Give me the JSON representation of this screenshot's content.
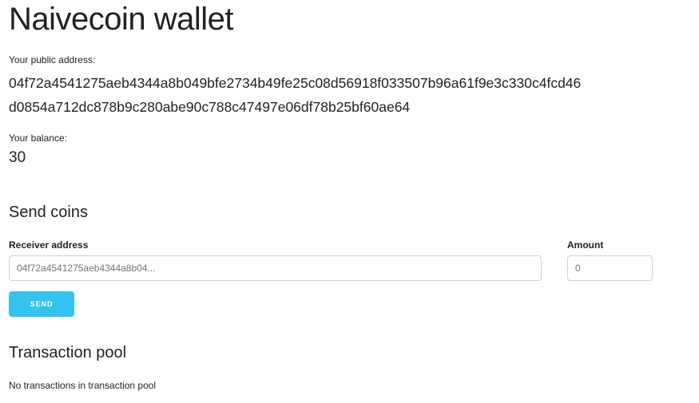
{
  "wallet": {
    "title": "Naivecoin wallet",
    "public_address_label": "Your public address:",
    "public_address_line1": "04f72a4541275aeb4344a8b049bfe2734b49fe25c08d56918f033507b96a61f9e3c330c4fcd46",
    "public_address_line2": "d0854a712dc878b9c280abe90c788c47497e06df78b25bf60ae64",
    "balance_label": "Your balance:",
    "balance_value": "30"
  },
  "send_coins": {
    "heading": "Send coins",
    "receiver_label": "Receiver address",
    "receiver_placeholder": "04f72a4541275aeb4344a8b04...",
    "amount_label": "Amount",
    "amount_placeholder": "0",
    "send_label": "SEND",
    "accent_color": "#33c3f0"
  },
  "transaction_pool": {
    "heading": "Transaction pool",
    "empty_message": "No transactions in transaction pool"
  }
}
